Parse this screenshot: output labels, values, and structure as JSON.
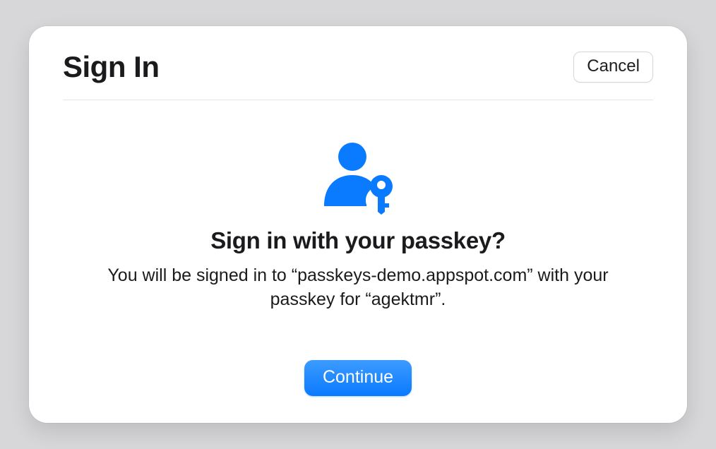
{
  "dialog": {
    "title": "Sign In",
    "cancel_label": "Cancel",
    "prompt_title": "Sign in with your passkey?",
    "prompt_subtitle": "You will be signed in to “passkeys-demo.appspot.com” with your passkey for “agektmr”.",
    "continue_label": "Continue",
    "accent_color": "#0a7aff"
  }
}
